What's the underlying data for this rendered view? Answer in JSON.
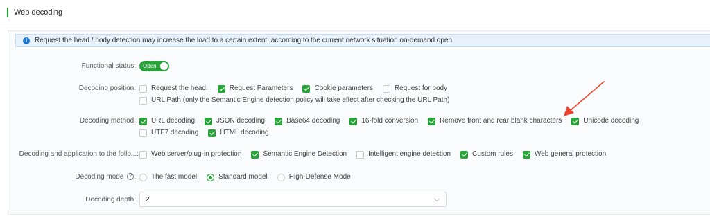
{
  "header": {
    "title": "Web decoding"
  },
  "info": {
    "text": "Request the head / body detection may increase the load to a certain extent, according to the current network situation on-demand open"
  },
  "functional_status": {
    "label": "Functional status:",
    "toggle_text": "Open",
    "enabled": true
  },
  "decoding_position": {
    "label": "Decoding position:",
    "row1": [
      {
        "label": "Request the head.",
        "checked": false
      },
      {
        "label": "Request Parameters",
        "checked": true
      },
      {
        "label": "Cookie parameters",
        "checked": true
      },
      {
        "label": "Request for body",
        "checked": false
      }
    ],
    "row2": [
      {
        "label": "URL Path (only the Semantic Engine detection policy will take effect after checking the URL Path)",
        "checked": false
      }
    ]
  },
  "decoding_method": {
    "label": "Decoding method:",
    "row1": [
      {
        "label": "URL decoding",
        "checked": true
      },
      {
        "label": "JSON decoding",
        "checked": true
      },
      {
        "label": "Base64 decoding",
        "checked": true
      },
      {
        "label": "16-fold conversion",
        "checked": true
      },
      {
        "label": "Remove front and rear blank characters",
        "checked": true
      },
      {
        "label": "Unicode decoding",
        "checked": true
      }
    ],
    "row2": [
      {
        "label": "UTF7 decoding",
        "checked": false
      },
      {
        "label": "HTML decoding",
        "checked": true
      }
    ]
  },
  "decoding_application": {
    "label": "Decoding and application to the follo...:",
    "items": [
      {
        "label": "Web server/plug-in protection",
        "checked": false
      },
      {
        "label": "Semantic Engine Detection",
        "checked": true
      },
      {
        "label": "Intelligent engine detection",
        "checked": false
      },
      {
        "label": "Custom rules",
        "checked": true
      },
      {
        "label": "Web general protection",
        "checked": true
      }
    ]
  },
  "decoding_mode": {
    "label": "Decoding mode",
    "help_icon": "?",
    "colon": ":",
    "options": [
      {
        "label": "The fast model",
        "selected": false
      },
      {
        "label": "Standard model",
        "selected": true
      },
      {
        "label": "High-Defense Mode",
        "selected": false
      }
    ]
  },
  "decoding_depth": {
    "label": "Decoding depth:",
    "value": "2"
  },
  "colors": {
    "accent": "#2aa33b",
    "info_bg": "#e8f2fc",
    "info_icon": "#1677d8",
    "annotation_arrow": "#e8452c"
  }
}
